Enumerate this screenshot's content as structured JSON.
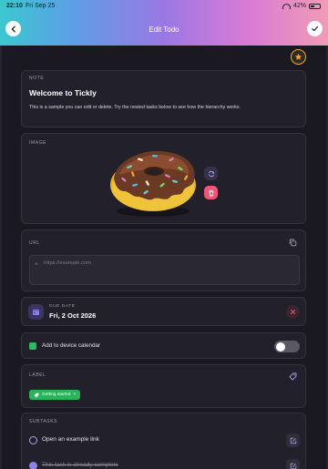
{
  "status_bar": {
    "time": "22:10",
    "date": "Fri Sep 25",
    "battery": "42%"
  },
  "header": {
    "title": "Edit Todo"
  },
  "note": {
    "label": "NOTE",
    "title": "Welcome to Tickly",
    "body": "This is a sample you can edit or delete. Try the nested tasks below to see how the hierarchy works."
  },
  "image": {
    "label": "IMAGE"
  },
  "url": {
    "label": "URL",
    "placeholder": "https://example.com"
  },
  "due_date": {
    "label": "DUE DATE",
    "value": "Fri, 2 Oct 2026"
  },
  "calendar": {
    "label": "Add to device calendar",
    "enabled": false
  },
  "label_section": {
    "label": "LABEL",
    "chip": "Getting started"
  },
  "subtasks": {
    "label": "SUBTASKS",
    "items": [
      {
        "text": "Open an example link",
        "done": false
      },
      {
        "text": "This task is already complete",
        "done": true
      }
    ]
  },
  "colors": {
    "accent": "#8b82e8",
    "danger": "#f0557a",
    "success": "#2bb35c",
    "star": "#f2a535"
  }
}
